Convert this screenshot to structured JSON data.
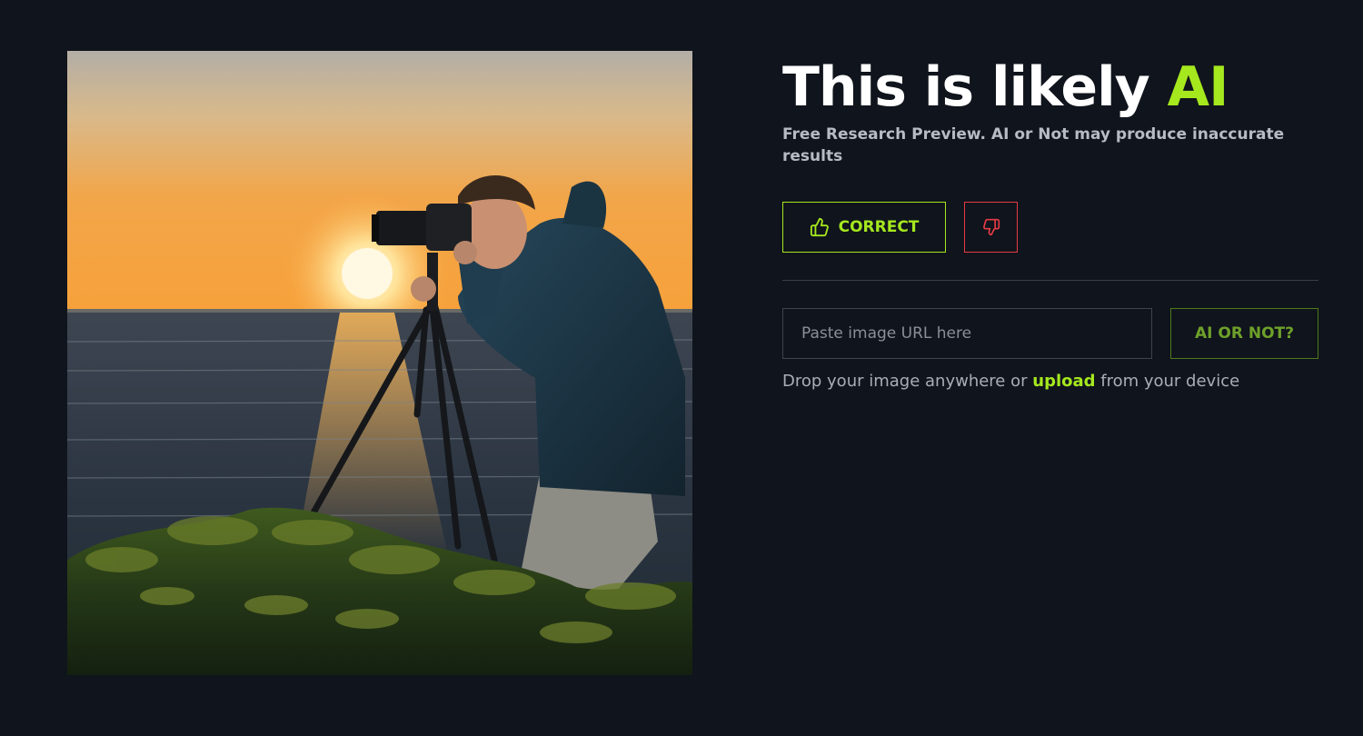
{
  "result": {
    "headline_prefix": "This is likely ",
    "headline_verdict": "AI",
    "disclaimer": "Free Research Preview. AI or Not may produce inaccurate results"
  },
  "feedback": {
    "correct_label": "CORRECT",
    "correct_icon": "thumbs-up-icon",
    "incorrect_icon": "thumbs-down-icon"
  },
  "checker": {
    "url_placeholder": "Paste image URL here",
    "url_value": "",
    "submit_label": "AI OR NOT?"
  },
  "upload_hint": {
    "before": "Drop your image anywhere or ",
    "link": "upload",
    "after": " from your device"
  },
  "colors": {
    "background": "#10141c",
    "accent": "#a5e81e",
    "danger": "#e53b45"
  }
}
